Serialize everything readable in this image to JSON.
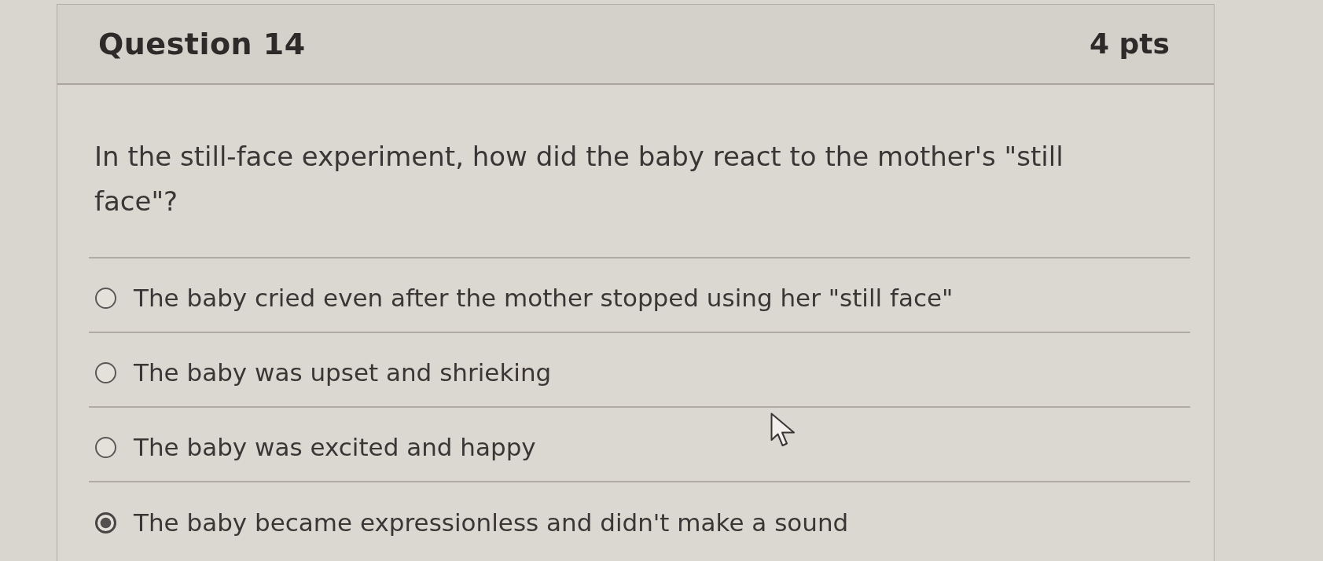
{
  "question": {
    "title": "Question 14",
    "points": "4 pts",
    "text": "In the still-face experiment, how did the baby react to the mother's \"still face\"?"
  },
  "answers": [
    {
      "label": "The baby cried even after the mother stopped using her \"still face\"",
      "selected": false
    },
    {
      "label": "The baby was upset and shrieking",
      "selected": false
    },
    {
      "label": "The baby was excited and happy",
      "selected": false
    },
    {
      "label": "The baby became expressionless and didn't make a sound",
      "selected": true
    }
  ]
}
